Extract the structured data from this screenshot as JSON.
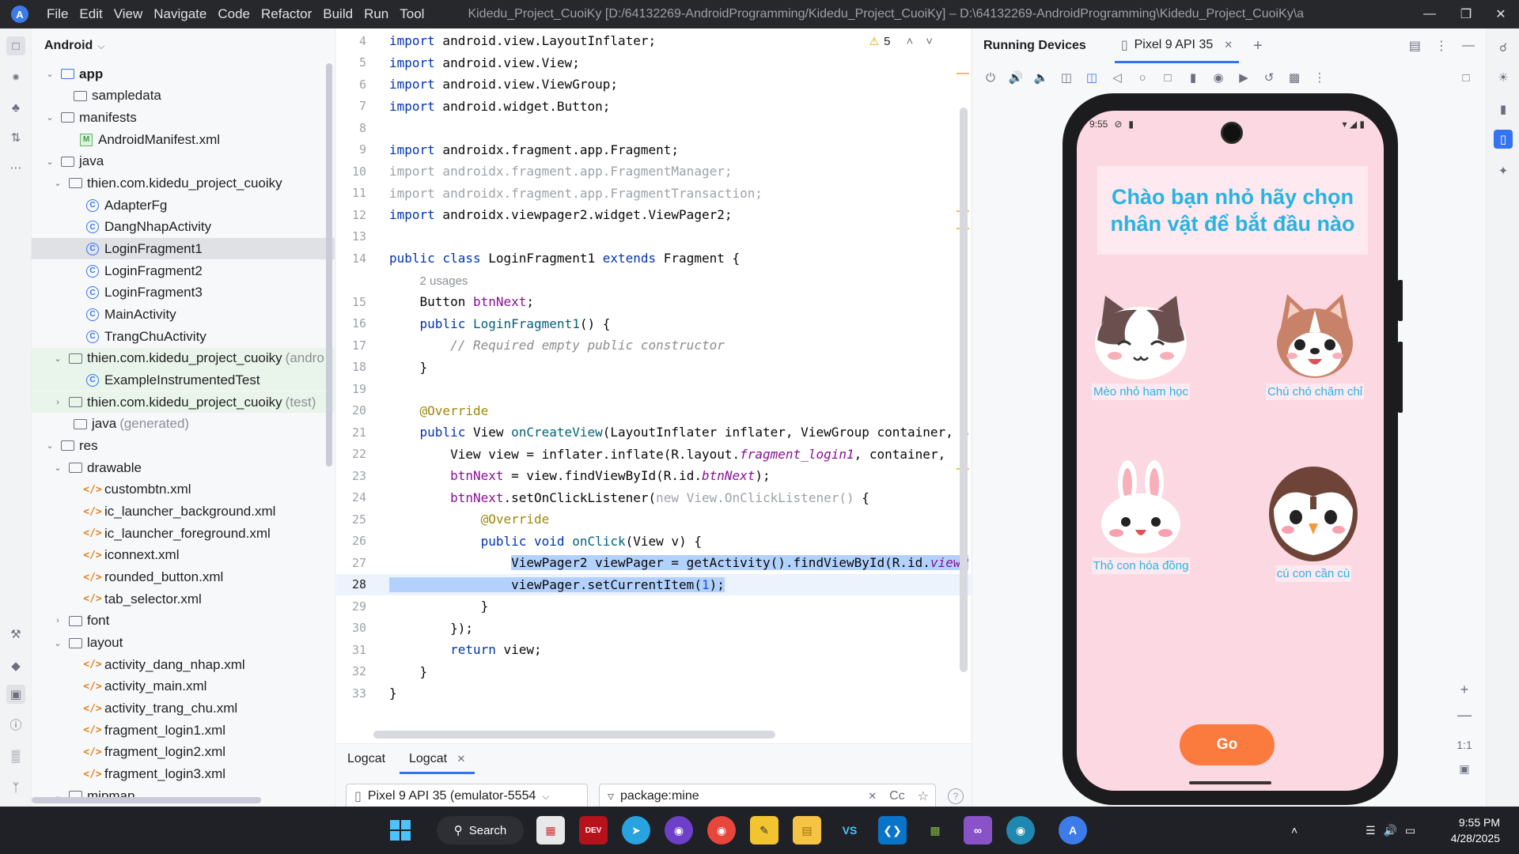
{
  "titlebar": {
    "menu": [
      "File",
      "Edit",
      "View",
      "Navigate",
      "Code",
      "Refactor",
      "Build",
      "Run",
      "Tool"
    ],
    "title": "Kidedu_Project_CuoiKy [D:/64132269-AndroidProgramming/Kidedu_Project_CuoiKy] – D:\\64132269-AndroidProgramming\\Kidedu_Project_CuoiKy\\a"
  },
  "project": {
    "view_label": "Android",
    "tree": [
      {
        "label": "app",
        "bold": true
      },
      {
        "label": "sampledata"
      },
      {
        "label": "manifests"
      },
      {
        "label": "AndroidManifest.xml"
      },
      {
        "label": "java"
      },
      {
        "label": "thien.com.kidedu_project_cuoiky"
      },
      {
        "label": "AdapterFg"
      },
      {
        "label": "DangNhapActivity"
      },
      {
        "label": "LoginFragment1"
      },
      {
        "label": "LoginFragment2"
      },
      {
        "label": "LoginFragment3"
      },
      {
        "label": "MainActivity"
      },
      {
        "label": "TrangChuActivity"
      },
      {
        "label": "thien.com.kidedu_project_cuoiky",
        "suffix": "(andro"
      },
      {
        "label": "ExampleInstrumentedTest"
      },
      {
        "label": "thien.com.kidedu_project_cuoiky",
        "suffix": "(test)"
      },
      {
        "label": "java",
        "suffix": "(generated)"
      },
      {
        "label": "res"
      },
      {
        "label": "drawable"
      },
      {
        "label": "custombtn.xml"
      },
      {
        "label": "ic_launcher_background.xml"
      },
      {
        "label": "ic_launcher_foreground.xml"
      },
      {
        "label": "iconnext.xml"
      },
      {
        "label": "rounded_button.xml"
      },
      {
        "label": "tab_selector.xml"
      },
      {
        "label": "font"
      },
      {
        "label": "layout"
      },
      {
        "label": "activity_dang_nhap.xml"
      },
      {
        "label": "activity_main.xml"
      },
      {
        "label": "activity_trang_chu.xml"
      },
      {
        "label": "fragment_login1.xml"
      },
      {
        "label": "fragment_login2.xml"
      },
      {
        "label": "fragment_login3.xml"
      },
      {
        "label": "mipmap"
      }
    ]
  },
  "editor": {
    "warnings": "5",
    "line_numbers": [
      "4",
      "5",
      "6",
      "7",
      "8",
      "9",
      "10",
      "11",
      "12",
      "13",
      "14",
      "",
      "15",
      "16",
      "17",
      "18",
      "19",
      "20",
      "21",
      "22",
      "23",
      "24",
      "25",
      "26",
      "27",
      "28",
      "29",
      "30",
      "31",
      "32",
      "33"
    ],
    "usages_hint": "2 usages"
  },
  "logcat": {
    "tabs": [
      "Logcat",
      "Logcat"
    ],
    "device": "Pixel 9 API 35 (emulator-5554",
    "filter": "package:mine",
    "case_label": "Cc"
  },
  "running_devices": {
    "title": "Running Devices",
    "device_tab": "Pixel 9 API 35",
    "zoom_label": "1:1",
    "phone": {
      "time": "9:55",
      "heading": "Chào bạn nhỏ hãy chọn nhân vật để bắt đầu nào",
      "characters": [
        "Mèo nhỏ ham học",
        "Chú chó chăm chỉ",
        "Thỏ con hóa đồng",
        "cú con cần cù"
      ],
      "go_button": "Go"
    }
  },
  "taskbar": {
    "search_label": "Search",
    "time": "9:55 PM",
    "date": "4/28/2025"
  },
  "colors": {
    "accent": "#3574f0",
    "phone_bg": "#fcd8e2",
    "heading_text": "#2ab3e0",
    "go_button": "#fb7a3e",
    "selection": "#b3d1fd"
  }
}
